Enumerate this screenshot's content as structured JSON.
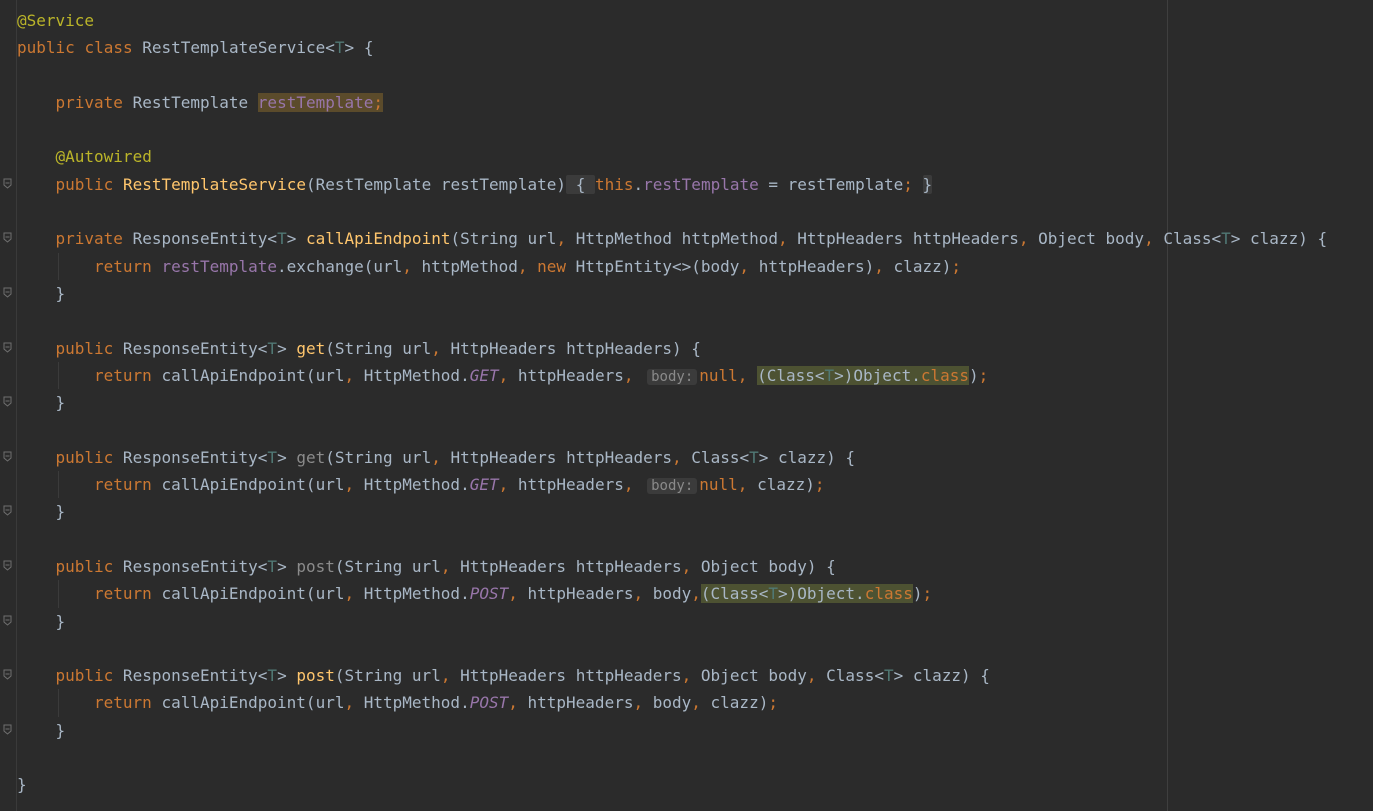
{
  "editor": {
    "lines": [
      {
        "id": "l1",
        "fold": false,
        "tokens": [
          {
            "t": "@Service",
            "c": "ann"
          }
        ]
      },
      {
        "id": "l2",
        "fold": false,
        "tokens": [
          {
            "t": "public",
            "c": "kw"
          },
          {
            "t": " ",
            "c": ""
          },
          {
            "t": "class",
            "c": "kw"
          },
          {
            "t": " RestTemplateService",
            "c": ""
          },
          {
            "t": "<",
            "c": ""
          },
          {
            "t": "T",
            "c": "gen"
          },
          {
            "t": "> {",
            "c": ""
          }
        ]
      },
      {
        "id": "l3",
        "fold": false,
        "tokens": []
      },
      {
        "id": "l4",
        "fold": false,
        "indent": 1,
        "tokens": [
          {
            "t": "private",
            "c": "kw"
          },
          {
            "t": " RestTemplate ",
            "c": ""
          },
          {
            "t": "restTemplate",
            "c": "field hl-field"
          },
          {
            "t": ";",
            "c": "kw hl-field"
          }
        ]
      },
      {
        "id": "l5",
        "fold": false,
        "tokens": []
      },
      {
        "id": "l6",
        "fold": false,
        "indent": 1,
        "tokens": [
          {
            "t": "@Autowired",
            "c": "ann"
          }
        ]
      },
      {
        "id": "l7",
        "fold": true,
        "indent": 1,
        "tokens": [
          {
            "t": "public",
            "c": "kw"
          },
          {
            "t": " ",
            "c": ""
          },
          {
            "t": "RestTemplateService",
            "c": "fn"
          },
          {
            "t": "(RestTemplate restTemplate)",
            "c": ""
          },
          {
            "t": " { ",
            "c": "fold-box"
          },
          {
            "t": "this",
            "c": "kw"
          },
          {
            "t": ".",
            "c": ""
          },
          {
            "t": "restTemplate",
            "c": "field"
          },
          {
            "t": " = restTemplate",
            "c": ""
          },
          {
            "t": "; ",
            "c": "kw"
          },
          {
            "t": "}",
            "c": "fold-box"
          }
        ]
      },
      {
        "id": "l8",
        "fold": false,
        "tokens": []
      },
      {
        "id": "l9",
        "fold": true,
        "indent": 1,
        "tokens": [
          {
            "t": "private",
            "c": "kw"
          },
          {
            "t": " ResponseEntity<",
            "c": ""
          },
          {
            "t": "T",
            "c": "gen"
          },
          {
            "t": "> ",
            "c": ""
          },
          {
            "t": "callApiEndpoint",
            "c": "fn"
          },
          {
            "t": "(String url",
            "c": ""
          },
          {
            "t": ", ",
            "c": "kw"
          },
          {
            "t": "HttpMethod httpMethod",
            "c": ""
          },
          {
            "t": ", ",
            "c": "kw"
          },
          {
            "t": "HttpHeaders httpHeaders",
            "c": ""
          },
          {
            "t": ", ",
            "c": "kw"
          },
          {
            "t": "Object body",
            "c": ""
          },
          {
            "t": ", ",
            "c": "kw"
          },
          {
            "t": "Class<",
            "c": ""
          },
          {
            "t": "T",
            "c": "gen"
          },
          {
            "t": "> clazz) {",
            "c": ""
          }
        ]
      },
      {
        "id": "l10",
        "fold": false,
        "indent": 2,
        "tokens": [
          {
            "t": "return ",
            "c": "kw"
          },
          {
            "t": "restTemplate",
            "c": "field"
          },
          {
            "t": ".exchange(url",
            "c": ""
          },
          {
            "t": ", ",
            "c": "kw"
          },
          {
            "t": "httpMethod",
            "c": ""
          },
          {
            "t": ", ",
            "c": "kw"
          },
          {
            "t": "new ",
            "c": "kw"
          },
          {
            "t": "HttpEntity<>(body",
            "c": ""
          },
          {
            "t": ", ",
            "c": "kw"
          },
          {
            "t": "httpHeaders)",
            "c": ""
          },
          {
            "t": ", ",
            "c": "kw"
          },
          {
            "t": "clazz)",
            "c": ""
          },
          {
            "t": ";",
            "c": "kw"
          }
        ]
      },
      {
        "id": "l11",
        "fold": true,
        "indent": 1,
        "tokens": [
          {
            "t": "}",
            "c": ""
          }
        ]
      },
      {
        "id": "l12",
        "fold": false,
        "tokens": []
      },
      {
        "id": "l13",
        "fold": true,
        "indent": 1,
        "tokens": [
          {
            "t": "public",
            "c": "kw"
          },
          {
            "t": " ResponseEntity<",
            "c": ""
          },
          {
            "t": "T",
            "c": "gen"
          },
          {
            "t": "> ",
            "c": ""
          },
          {
            "t": "get",
            "c": "fn"
          },
          {
            "t": "(String url",
            "c": ""
          },
          {
            "t": ", ",
            "c": "kw"
          },
          {
            "t": "HttpHeaders httpHeaders) {",
            "c": ""
          }
        ]
      },
      {
        "id": "l14",
        "fold": false,
        "indent": 2,
        "tokens": [
          {
            "t": "return ",
            "c": "kw"
          },
          {
            "t": "callApiEndpoint(url",
            "c": ""
          },
          {
            "t": ", ",
            "c": "kw"
          },
          {
            "t": "HttpMethod.",
            "c": ""
          },
          {
            "t": "GET",
            "c": "const"
          },
          {
            "t": ", ",
            "c": "kw"
          },
          {
            "t": "httpHeaders",
            "c": ""
          },
          {
            "t": ", ",
            "c": "kw"
          },
          {
            "t": "body:",
            "c": "hint"
          },
          {
            "t": "null",
            "c": "kw"
          },
          {
            "t": ", ",
            "c": "kw"
          },
          {
            "t": "(Class<",
            "c": "hl-cast"
          },
          {
            "t": "T",
            "c": "gen hl-cast"
          },
          {
            "t": ">)Object.",
            "c": "hl-cast"
          },
          {
            "t": "class",
            "c": "kw hl-cast"
          },
          {
            "t": ")",
            "c": ""
          },
          {
            "t": ";",
            "c": "kw"
          }
        ]
      },
      {
        "id": "l15",
        "fold": true,
        "indent": 1,
        "tokens": [
          {
            "t": "}",
            "c": ""
          }
        ]
      },
      {
        "id": "l16",
        "fold": false,
        "tokens": []
      },
      {
        "id": "l17",
        "fold": true,
        "indent": 1,
        "tokens": [
          {
            "t": "public",
            "c": "kw"
          },
          {
            "t": " ResponseEntity<",
            "c": ""
          },
          {
            "t": "T",
            "c": "gen"
          },
          {
            "t": "> ",
            "c": ""
          },
          {
            "t": "get",
            "c": "dim"
          },
          {
            "t": "(String url",
            "c": ""
          },
          {
            "t": ", ",
            "c": "kw"
          },
          {
            "t": "HttpHeaders httpHeaders",
            "c": ""
          },
          {
            "t": ", ",
            "c": "kw"
          },
          {
            "t": "Class<",
            "c": ""
          },
          {
            "t": "T",
            "c": "gen"
          },
          {
            "t": "> clazz) {",
            "c": ""
          }
        ]
      },
      {
        "id": "l18",
        "fold": false,
        "indent": 2,
        "tokens": [
          {
            "t": "return ",
            "c": "kw"
          },
          {
            "t": "callApiEndpoint(url",
            "c": ""
          },
          {
            "t": ", ",
            "c": "kw"
          },
          {
            "t": "HttpMethod.",
            "c": ""
          },
          {
            "t": "GET",
            "c": "const"
          },
          {
            "t": ", ",
            "c": "kw"
          },
          {
            "t": "httpHeaders",
            "c": ""
          },
          {
            "t": ", ",
            "c": "kw"
          },
          {
            "t": "body:",
            "c": "hint"
          },
          {
            "t": "null",
            "c": "kw"
          },
          {
            "t": ", ",
            "c": "kw"
          },
          {
            "t": "clazz)",
            "c": ""
          },
          {
            "t": ";",
            "c": "kw"
          }
        ]
      },
      {
        "id": "l19",
        "fold": true,
        "indent": 1,
        "tokens": [
          {
            "t": "}",
            "c": ""
          }
        ]
      },
      {
        "id": "l20",
        "fold": false,
        "tokens": []
      },
      {
        "id": "l21",
        "fold": true,
        "indent": 1,
        "tokens": [
          {
            "t": "public",
            "c": "kw"
          },
          {
            "t": " ResponseEntity<",
            "c": ""
          },
          {
            "t": "T",
            "c": "gen"
          },
          {
            "t": "> ",
            "c": ""
          },
          {
            "t": "post",
            "c": "dim"
          },
          {
            "t": "(String url",
            "c": ""
          },
          {
            "t": ", ",
            "c": "kw"
          },
          {
            "t": "HttpHeaders httpHeaders",
            "c": ""
          },
          {
            "t": ", ",
            "c": "kw"
          },
          {
            "t": "Object body) {",
            "c": ""
          }
        ]
      },
      {
        "id": "l22",
        "fold": false,
        "indent": 2,
        "tokens": [
          {
            "t": "return ",
            "c": "kw"
          },
          {
            "t": "callApiEndpoint(url",
            "c": ""
          },
          {
            "t": ", ",
            "c": "kw"
          },
          {
            "t": "HttpMethod.",
            "c": ""
          },
          {
            "t": "POST",
            "c": "const"
          },
          {
            "t": ", ",
            "c": "kw"
          },
          {
            "t": "httpHeaders",
            "c": ""
          },
          {
            "t": ", ",
            "c": "kw"
          },
          {
            "t": "body",
            "c": ""
          },
          {
            "t": ",",
            "c": "kw"
          },
          {
            "t": "(Class<",
            "c": "hl-cast"
          },
          {
            "t": "T",
            "c": "gen hl-cast"
          },
          {
            "t": ">)Object.",
            "c": "hl-cast"
          },
          {
            "t": "class",
            "c": "kw hl-cast"
          },
          {
            "t": ")",
            "c": ""
          },
          {
            "t": ";",
            "c": "kw"
          }
        ]
      },
      {
        "id": "l23",
        "fold": true,
        "indent": 1,
        "tokens": [
          {
            "t": "}",
            "c": ""
          }
        ]
      },
      {
        "id": "l24",
        "fold": false,
        "tokens": []
      },
      {
        "id": "l25",
        "fold": true,
        "indent": 1,
        "tokens": [
          {
            "t": "public",
            "c": "kw"
          },
          {
            "t": " ResponseEntity<",
            "c": ""
          },
          {
            "t": "T",
            "c": "gen"
          },
          {
            "t": "> ",
            "c": ""
          },
          {
            "t": "post",
            "c": "fn"
          },
          {
            "t": "(String url",
            "c": ""
          },
          {
            "t": ", ",
            "c": "kw"
          },
          {
            "t": "HttpHeaders httpHeaders",
            "c": ""
          },
          {
            "t": ", ",
            "c": "kw"
          },
          {
            "t": "Object body",
            "c": ""
          },
          {
            "t": ", ",
            "c": "kw"
          },
          {
            "t": "Class<",
            "c": ""
          },
          {
            "t": "T",
            "c": "gen"
          },
          {
            "t": "> clazz) {",
            "c": ""
          }
        ]
      },
      {
        "id": "l26",
        "fold": false,
        "indent": 2,
        "tokens": [
          {
            "t": "return ",
            "c": "kw"
          },
          {
            "t": "callApiEndpoint(url",
            "c": ""
          },
          {
            "t": ", ",
            "c": "kw"
          },
          {
            "t": "HttpMethod.",
            "c": ""
          },
          {
            "t": "POST",
            "c": "const"
          },
          {
            "t": ", ",
            "c": "kw"
          },
          {
            "t": "httpHeaders",
            "c": ""
          },
          {
            "t": ", ",
            "c": "kw"
          },
          {
            "t": "body",
            "c": ""
          },
          {
            "t": ", ",
            "c": "kw"
          },
          {
            "t": "clazz)",
            "c": ""
          },
          {
            "t": ";",
            "c": "kw"
          }
        ]
      },
      {
        "id": "l27",
        "fold": true,
        "indent": 1,
        "tokens": [
          {
            "t": "}",
            "c": ""
          }
        ]
      },
      {
        "id": "l28",
        "fold": false,
        "tokens": []
      },
      {
        "id": "l29",
        "fold": false,
        "tokens": [
          {
            "t": "}",
            "c": ""
          }
        ]
      }
    ]
  },
  "colors": {
    "background": "#2b2b2b",
    "keyword": "#cc7832",
    "annotation": "#bbb529",
    "field": "#9876aa",
    "method_declaration": "#ffc66d",
    "type_parameter": "#507874",
    "default_text": "#a9b7c6"
  },
  "icons": {
    "fold_marker": "fold-marker-icon"
  }
}
